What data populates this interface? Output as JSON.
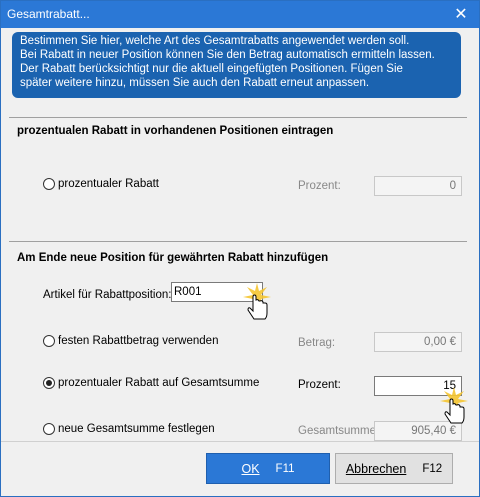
{
  "window": {
    "title": "Gesamtrabatt...",
    "close_label": "✕"
  },
  "info": {
    "lines": [
      "Bestimmen Sie hier, welche Art des Gesamtrabatts angewendet werden soll.",
      "Bei Rabatt in neuer Position können Sie den Betrag automatisch ermitteln lassen.",
      "Der Rabatt berücksichtigt nur die aktuell eingefügten Positionen. Fügen Sie",
      "später weitere hinzu, müssen Sie auch den Rabatt erneut anpassen."
    ]
  },
  "section1": {
    "title": "prozentualen Rabatt in vorhandenen Positionen eintragen",
    "option_label": "prozentualer Rabatt",
    "field_label": "Prozent:",
    "field_value": "0"
  },
  "section2": {
    "title": "Am Ende neue Position für gewährten Rabatt hinzufügen",
    "article_label": "Artikel für Rabattposition:",
    "article_value": "R001",
    "options": [
      {
        "label": "festen Rabattbetrag verwenden",
        "field_label": "Betrag:",
        "value": "0,00 €",
        "checked": false
      },
      {
        "label": "prozentualer Rabatt auf Gesamtsumme",
        "field_label": "Prozent:",
        "value": "15",
        "checked": true
      },
      {
        "label": "neue Gesamtsumme festlegen",
        "field_label": "Gesamtsumme",
        "value": "905,40 €",
        "checked": false
      }
    ]
  },
  "footer": {
    "ok_label": "OK",
    "ok_key": "F11",
    "cancel_label": "Abbrechen",
    "cancel_key": "F12"
  }
}
